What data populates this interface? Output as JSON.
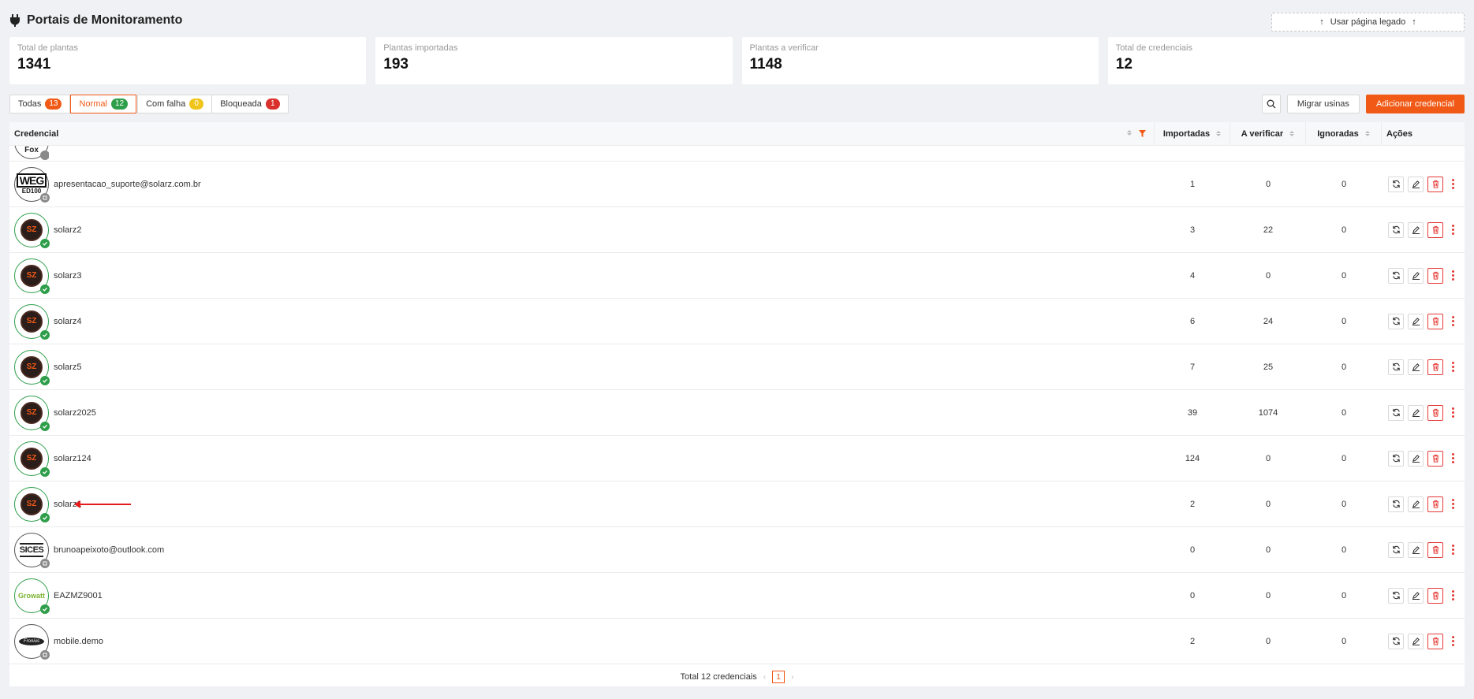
{
  "header": {
    "title": "Portais de Monitoramento",
    "legacy_button": "Usar página legado"
  },
  "stats": [
    {
      "label": "Total de plantas",
      "value": "1341"
    },
    {
      "label": "Plantas importadas",
      "value": "193"
    },
    {
      "label": "Plantas a verificar",
      "value": "1148"
    },
    {
      "label": "Total de credenciais",
      "value": "12"
    }
  ],
  "tabs": [
    {
      "label": "Todas",
      "count": "13",
      "color": "#f05a16"
    },
    {
      "label": "Normal",
      "count": "12",
      "color": "#2e9e4a",
      "active": true
    },
    {
      "label": "Com falha",
      "count": "0",
      "color": "#f0c419"
    },
    {
      "label": "Bloqueada",
      "count": "1",
      "color": "#d9302c"
    }
  ],
  "toolbar": {
    "migrate_label": "Migrar usinas",
    "add_label": "Adicionar credencial"
  },
  "table": {
    "columns": {
      "credential": "Credencial",
      "imported": "Importadas",
      "to_verify": "A verificar",
      "ignored": "Ignoradas",
      "actions": "Ações"
    },
    "partial_row_logo": "Fox",
    "rows": [
      {
        "name": "apresentacao_suporte@solarz.com.br",
        "imported": "1",
        "to_verify": "0",
        "ignored": "0",
        "logo": "weg",
        "logo_text": "WEG",
        "logo_sub": "ED100",
        "status": "grey"
      },
      {
        "name": "solarz2",
        "imported": "3",
        "to_verify": "22",
        "ignored": "0",
        "logo": "sz",
        "logo_text": "SZ",
        "status": "green"
      },
      {
        "name": "solarz3",
        "imported": "4",
        "to_verify": "0",
        "ignored": "0",
        "logo": "sz",
        "logo_text": "SZ",
        "status": "green"
      },
      {
        "name": "solarz4",
        "imported": "6",
        "to_verify": "24",
        "ignored": "0",
        "logo": "sz",
        "logo_text": "SZ",
        "status": "green"
      },
      {
        "name": "solarz5",
        "imported": "7",
        "to_verify": "25",
        "ignored": "0",
        "logo": "sz",
        "logo_text": "SZ",
        "status": "green"
      },
      {
        "name": "solarz2025",
        "imported": "39",
        "to_verify": "1074",
        "ignored": "0",
        "logo": "sz",
        "logo_text": "SZ",
        "status": "green"
      },
      {
        "name": "solarz124",
        "imported": "124",
        "to_verify": "0",
        "ignored": "0",
        "logo": "sz",
        "logo_text": "SZ",
        "status": "green"
      },
      {
        "name": "solarz1",
        "imported": "2",
        "to_verify": "0",
        "ignored": "0",
        "logo": "sz",
        "logo_text": "SZ",
        "status": "green",
        "arrow": true
      },
      {
        "name": "brunoapeixoto@outlook.com",
        "imported": "0",
        "to_verify": "0",
        "ignored": "0",
        "logo": "sices",
        "logo_text": "SICES",
        "status": "grey"
      },
      {
        "name": "EAZMZ9001",
        "imported": "0",
        "to_verify": "0",
        "ignored": "0",
        "logo": "growatt",
        "logo_text": "Growatt",
        "status": "green"
      },
      {
        "name": "mobile.demo",
        "imported": "2",
        "to_verify": "0",
        "ignored": "0",
        "logo": "fronius",
        "logo_text": "Fronius",
        "status": "grey"
      }
    ]
  },
  "pagination": {
    "total_label": "Total 12 credenciais",
    "current_page": "1"
  }
}
